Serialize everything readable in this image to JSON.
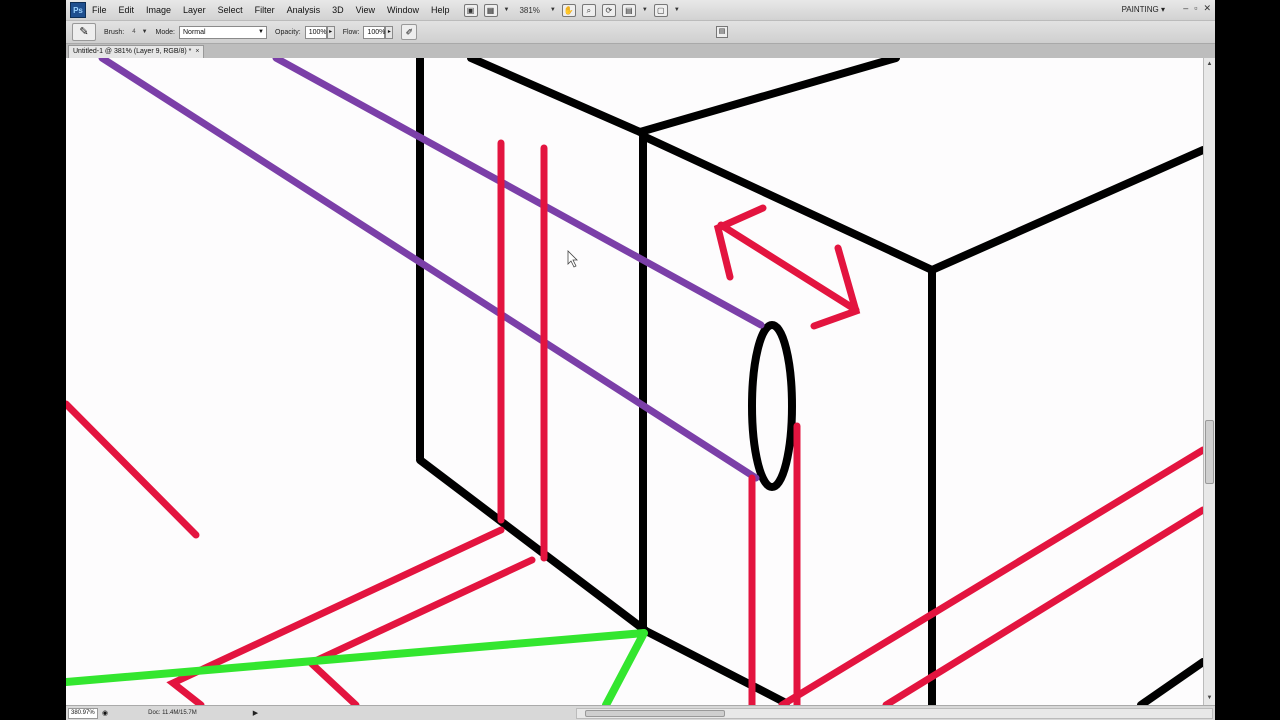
{
  "app": {
    "logo_text": "Ps",
    "menu": [
      "File",
      "Edit",
      "Image",
      "Layer",
      "Select",
      "Filter",
      "Analysis",
      "3D",
      "View",
      "Window",
      "Help"
    ],
    "zoom_combo": "381%",
    "workspace": "PAINTING",
    "window_buttons": [
      "–",
      "▫",
      "✕"
    ]
  },
  "options": {
    "brush_label": "Brush:",
    "brush_size": "4",
    "mode_label": "Mode:",
    "mode_value": "Normal",
    "opacity_label": "Opacity:",
    "opacity_value": "100%",
    "flow_label": "Flow:",
    "flow_value": "100%"
  },
  "document": {
    "tab_title": "Untitled-1 @ 381% (Layer 9, RGB/8) *",
    "close": "×"
  },
  "status": {
    "zoom": "380.97%",
    "doc_info": "Doc: 11.4M/15.7M"
  },
  "colors": {
    "ink_black": "#000000",
    "ink_purple": "#7b3fa8",
    "ink_red": "#e3143f",
    "ink_green": "#33e62f",
    "canvas_bg": "#fdfcfd"
  }
}
